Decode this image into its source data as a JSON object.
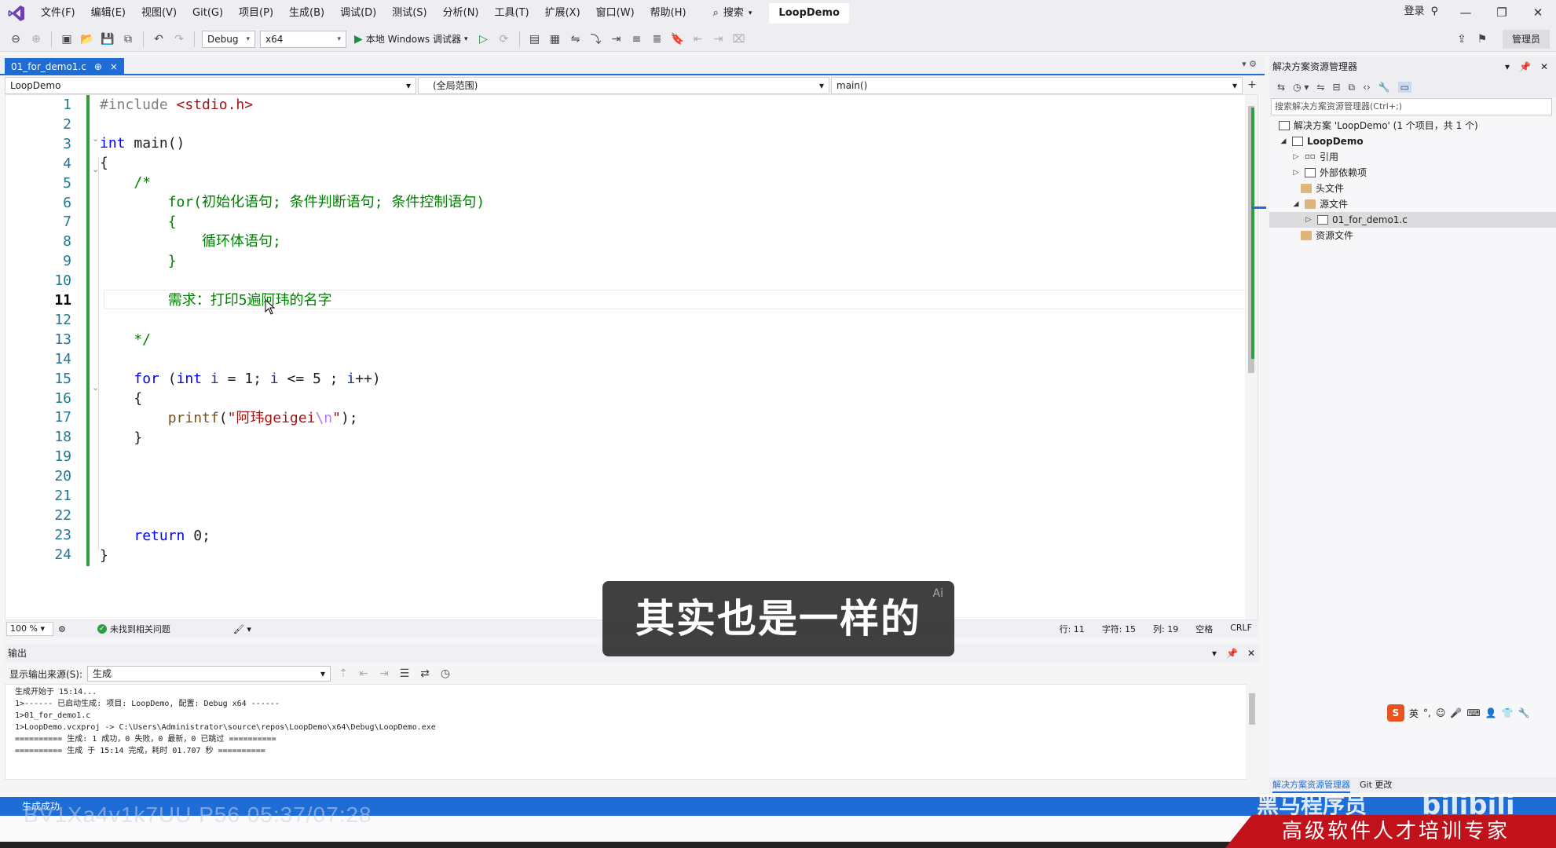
{
  "menubar": {
    "items": [
      "文件(F)",
      "编辑(E)",
      "视图(V)",
      "Git(G)",
      "项目(P)",
      "生成(B)",
      "调试(D)",
      "测试(S)",
      "分析(N)",
      "工具(T)",
      "扩展(X)",
      "窗口(W)",
      "帮助(H)"
    ],
    "search_label": "搜索",
    "solution_title": "LoopDemo",
    "login_label": "登录"
  },
  "toolbar": {
    "config": "Debug",
    "platform": "x64",
    "run_label": "本地 Windows 调试器",
    "admin_label": "管理员"
  },
  "editor_tab": {
    "filename": "01_for_demo1.c",
    "pin": "⊕",
    "close": "×"
  },
  "navbar": {
    "project": "LoopDemo",
    "scope": "(全局范围)",
    "function": "main()"
  },
  "code": {
    "current_line": 11,
    "lines": [
      "#include <stdio.h>",
      "",
      "int main()",
      "{",
      "    /*",
      "        for(初始化语句; 条件判断语句; 条件控制语句)",
      "        {",
      "            循环体语句;",
      "        }",
      "",
      "        需求：打印5遍阿玮的名字",
      "",
      "    */",
      "",
      "    for (int i = 1; i <= 5 ; i++)",
      "    {",
      "        printf(\"阿玮geigei\\n\");",
      "    }",
      "",
      "",
      "",
      "",
      "    return 0;",
      "}"
    ]
  },
  "editor_status": {
    "zoom": "100 %",
    "issues": "未找到相关问题",
    "line": "行: 11",
    "char": "字符: 15",
    "col": "列: 19",
    "whitespace": "空格",
    "eol": "CRLF"
  },
  "output": {
    "title": "输出",
    "source_label": "显示输出来源(S):",
    "source_value": "生成",
    "lines": [
      "生成开始于 15:14...",
      "1>------ 已启动生成: 项目: LoopDemo, 配置: Debug x64 ------",
      "1>01_for_demo1.c",
      "1>LoopDemo.vcxproj -> C:\\Users\\Administrator\\source\\repos\\LoopDemo\\x64\\Debug\\LoopDemo.exe",
      "========== 生成: 1 成功，0 失败，0 最新，0 已跳过 ==========",
      "========== 生成 于 15:14 完成，耗时 01.707 秒 =========="
    ]
  },
  "solution_explorer": {
    "title": "解决方案资源管理器",
    "search_placeholder": "搜索解决方案资源管理器(Ctrl+;)",
    "tree": [
      {
        "label": "解决方案 'LoopDemo' (1 个项目，共 1 个)",
        "icon": "solution-icon"
      },
      {
        "label": "LoopDemo",
        "icon": "project-icon"
      },
      {
        "label": "引用",
        "icon": "references-icon"
      },
      {
        "label": "外部依赖项",
        "icon": "external-deps-icon"
      },
      {
        "label": "头文件",
        "icon": "folder-icon"
      },
      {
        "label": "源文件",
        "icon": "folder-icon"
      },
      {
        "label": "01_for_demo1.c",
        "icon": "c-file-icon"
      },
      {
        "label": "资源文件",
        "icon": "folder-icon"
      }
    ],
    "bottom_tabs": [
      "解决方案资源管理器",
      "Git 更改"
    ]
  },
  "ime": {
    "logo": "S",
    "mode": "英"
  },
  "statusbar": {
    "text": "生成成功"
  },
  "subtitle": {
    "text": "其实也是一样的",
    "badge": "Ai"
  },
  "watermarks": {
    "video_id": "BV1Xa4v1k7UU P56 05:37/07:28",
    "brand": "黑马程序员",
    "slogan": "高级软件人才培训专家",
    "bili": "bilibili"
  },
  "colors": {
    "accent": "#1e6dd6",
    "keyword": "#0000ff",
    "comment": "#008000",
    "string": "#a31515",
    "change_bar": "#2e9e40"
  }
}
